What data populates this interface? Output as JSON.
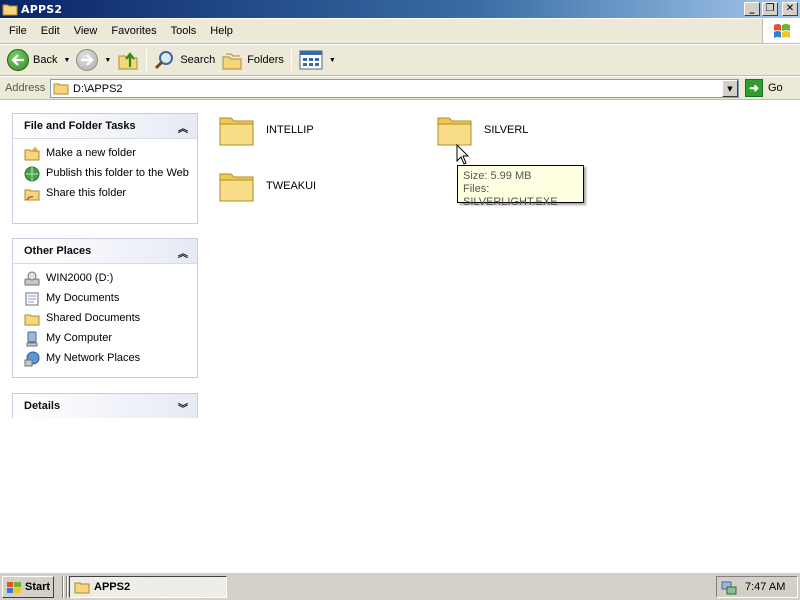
{
  "window": {
    "title": "APPS2",
    "controls": {
      "minimize": "_",
      "maximize": "❐",
      "close": "✕"
    }
  },
  "menu": {
    "items": [
      "File",
      "Edit",
      "View",
      "Favorites",
      "Tools",
      "Help"
    ]
  },
  "toolbar": {
    "back_label": "Back",
    "search_label": "Search",
    "folders_label": "Folders"
  },
  "address": {
    "label": "Address",
    "value": "D:\\APPS2",
    "go_label": "Go"
  },
  "tasks_panel": {
    "title": "File and Folder Tasks",
    "items": [
      {
        "label": "Make a new folder",
        "icon": "new-folder-icon"
      },
      {
        "label": "Publish this folder to the Web",
        "icon": "publish-web-icon"
      },
      {
        "label": "Share this folder",
        "icon": "share-folder-icon"
      }
    ]
  },
  "places_panel": {
    "title": "Other Places",
    "items": [
      {
        "label": "WIN2000 (D:)",
        "icon": "drive-icon"
      },
      {
        "label": "My Documents",
        "icon": "my-documents-icon"
      },
      {
        "label": "Shared Documents",
        "icon": "shared-documents-icon"
      },
      {
        "label": "My Computer",
        "icon": "my-computer-icon"
      },
      {
        "label": "My Network Places",
        "icon": "network-places-icon"
      }
    ]
  },
  "details_panel": {
    "title": "Details"
  },
  "folders": [
    {
      "name": "INTELLIP"
    },
    {
      "name": "SILVERL"
    },
    {
      "name": "TWEAKUI"
    }
  ],
  "tooltip": {
    "line1": "Size: 5.99 MB",
    "line2": "Files: SILVERLIGHT.EXE"
  },
  "taskbar": {
    "start_label": "Start",
    "task_label": "APPS2",
    "clock": "7:47 AM"
  },
  "colors": {
    "titlebar": "#0a246a",
    "folder": "#f5d67a",
    "tooltip_bg": "#ffffe1"
  }
}
